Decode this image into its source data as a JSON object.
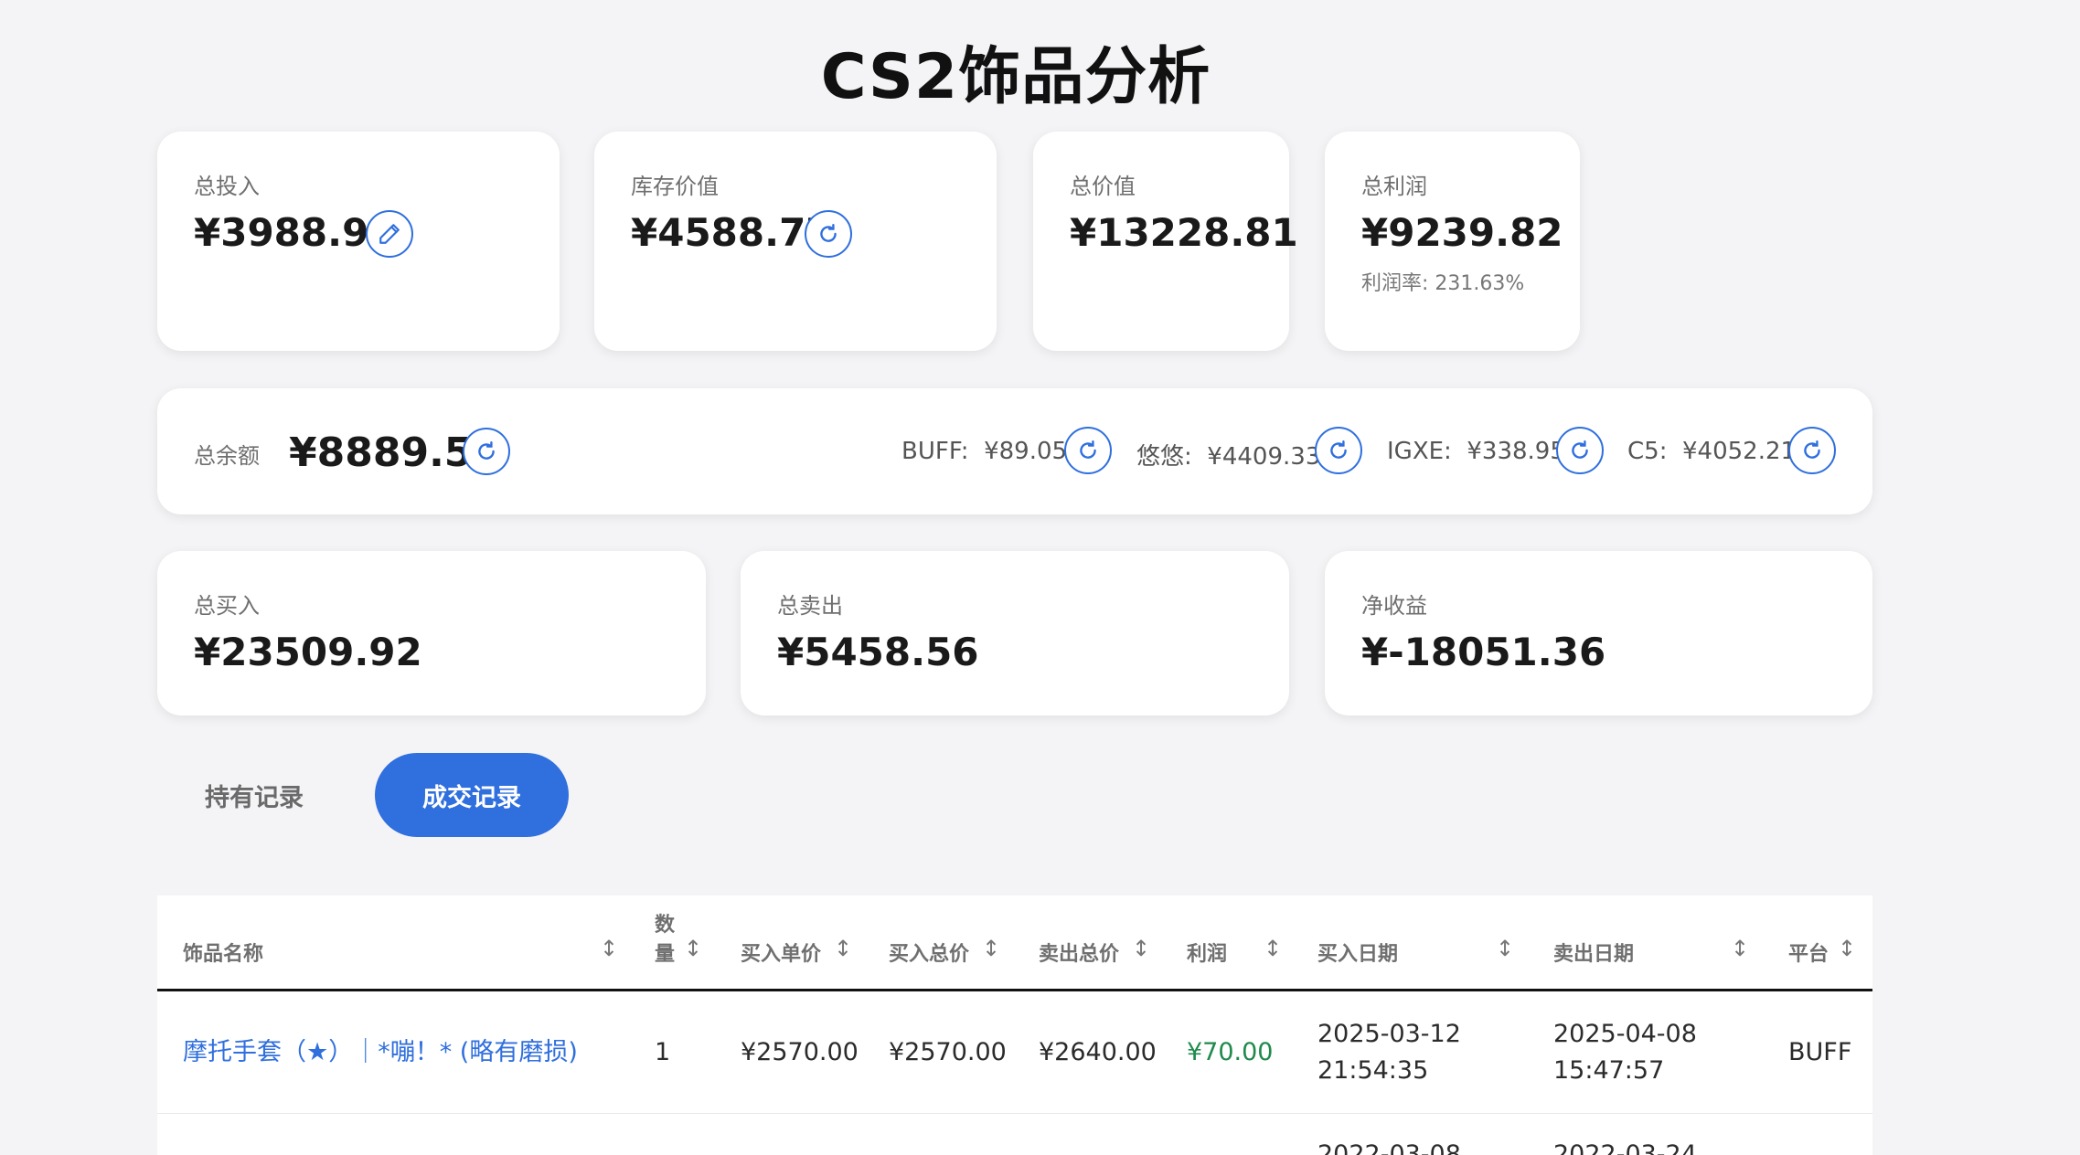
{
  "page": {
    "title": "CS2饰品分析"
  },
  "summary": {
    "investment": {
      "label": "总投入",
      "value": "¥3988.99"
    },
    "inventory": {
      "label": "库存价值",
      "value": "¥4588.77"
    },
    "total_value": {
      "label": "总价值",
      "value": "¥13228.81"
    },
    "total_profit": {
      "label": "总利润",
      "value": "¥9239.82",
      "rate": "利润率: 231.63%"
    }
  },
  "balance": {
    "label": "总余额",
    "value": "¥8889.54",
    "platforms": [
      {
        "name": "BUFF:",
        "value": "¥89.05"
      },
      {
        "name": "悠悠:",
        "value": "¥4409.33"
      },
      {
        "name": "IGXE:",
        "value": "¥338.95"
      },
      {
        "name": "C5:",
        "value": "¥4052.21"
      }
    ]
  },
  "trade_totals": {
    "buy": {
      "label": "总买入",
      "value": "¥23509.92"
    },
    "sell": {
      "label": "总卖出",
      "value": "¥5458.56"
    },
    "net": {
      "label": "净收益",
      "value": "¥-18051.36"
    }
  },
  "tabs": [
    {
      "label": "持有记录",
      "active": false
    },
    {
      "label": "成交记录",
      "active": true
    }
  ],
  "table": {
    "headers": [
      "饰品名称",
      "数",
      "量",
      "买入单价",
      "买入总价",
      "卖出总价",
      "利润",
      "买入日期",
      "卖出日期",
      "平台"
    ],
    "sort_glyph": "↕",
    "rows": [
      {
        "name": "摩托手套（★）｜*嘣！* (略有磨损)",
        "qty": "1",
        "unit_price": "¥2570.00",
        "buy_total": "¥2570.00",
        "sell_total": "¥2640.00",
        "profit": "¥70.00",
        "buy_date": "2025-03-12",
        "buy_time": "21:54:35",
        "sell_date": "2025-04-08",
        "sell_time": "15:47:57",
        "platform": "BUFF"
      },
      {
        "buy_date": "2022-03-08",
        "sell_date": "2022-03-24"
      }
    ]
  },
  "colors": {
    "accent": "#2f6fde",
    "profit": "#1f8a4c",
    "background": "#f4f4f6"
  },
  "icons": {
    "edit": "pencil-icon",
    "refresh": "refresh-icon",
    "sort": "sort-icon"
  }
}
